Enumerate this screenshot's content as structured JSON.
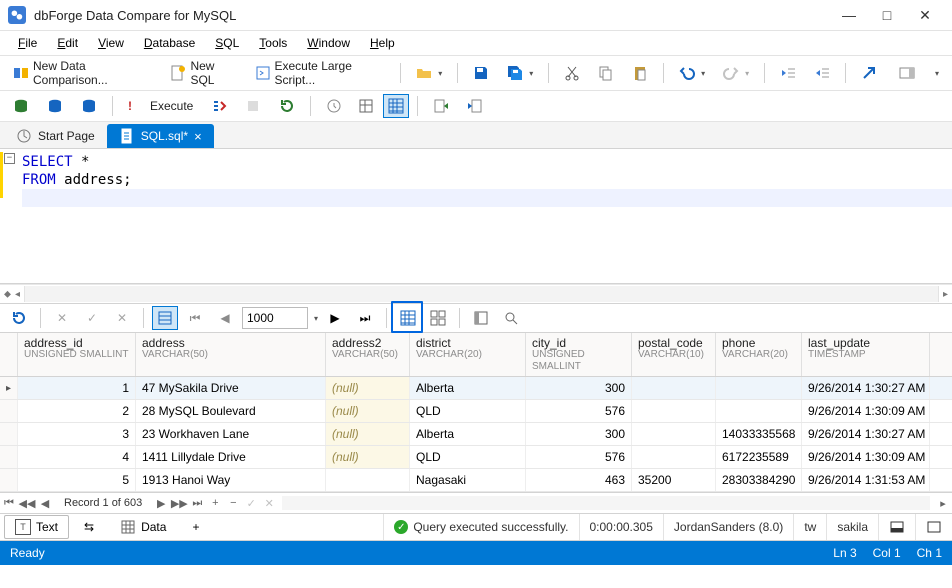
{
  "window": {
    "title": "dbForge Data Compare for MySQL"
  },
  "menu": {
    "file": "File",
    "edit": "Edit",
    "view": "View",
    "database": "Database",
    "sql": "SQL",
    "tools": "Tools",
    "window": "Window",
    "help": "Help"
  },
  "toolbar1": {
    "new_comp": "New Data Comparison...",
    "new_sql": "New SQL",
    "exec_script": "Execute Large Script..."
  },
  "toolbar2": {
    "execute": "Execute"
  },
  "tabs": {
    "start": "Start Page",
    "active": "SQL.sql*"
  },
  "sql": {
    "line1_kw": "SELECT",
    "line1_rest": " *",
    "line2_kw": "FROM",
    "line2_rest": " address;"
  },
  "midbar": {
    "page_size": "1000"
  },
  "grid": {
    "cols": [
      {
        "n": "address_id",
        "t": "UNSIGNED SMALLINT"
      },
      {
        "n": "address",
        "t": "VARCHAR(50)"
      },
      {
        "n": "address2",
        "t": "VARCHAR(50)"
      },
      {
        "n": "district",
        "t": "VARCHAR(20)"
      },
      {
        "n": "city_id",
        "t": "UNSIGNED SMALLINT"
      },
      {
        "n": "postal_code",
        "t": "VARCHAR(10)"
      },
      {
        "n": "phone",
        "t": "VARCHAR(20)"
      },
      {
        "n": "last_update",
        "t": "TIMESTAMP"
      }
    ],
    "rows": [
      {
        "id": "1",
        "addr": "47 MySakila Drive",
        "a2": null,
        "dist": "Alberta",
        "city": "300",
        "post": "",
        "ph": "",
        "lu": "9/26/2014 1:30:27 AM"
      },
      {
        "id": "2",
        "addr": "28 MySQL Boulevard",
        "a2": null,
        "dist": "QLD",
        "city": "576",
        "post": "",
        "ph": "",
        "lu": "9/26/2014 1:30:09 AM"
      },
      {
        "id": "3",
        "addr": "23 Workhaven Lane",
        "a2": null,
        "dist": "Alberta",
        "city": "300",
        "post": "",
        "ph": "14033335568",
        "lu": "9/26/2014 1:30:27 AM"
      },
      {
        "id": "4",
        "addr": "1411 Lillydale Drive",
        "a2": null,
        "dist": "QLD",
        "city": "576",
        "post": "",
        "ph": "6172235589",
        "lu": "9/26/2014 1:30:09 AM"
      },
      {
        "id": "5",
        "addr": "1913 Hanoi Way",
        "a2": "",
        "dist": "Nagasaki",
        "city": "463",
        "post": "35200",
        "ph": "28303384290",
        "lu": "9/26/2014 1:31:53 AM"
      }
    ],
    "record": "Record 1 of 603"
  },
  "bottom_tabs": {
    "text": "Text",
    "data": "Data"
  },
  "status_right": {
    "msg": "Query executed successfully.",
    "time": "0:00:00.305",
    "conn": "JordanSanders (8.0)",
    "user": "tw",
    "db": "sakila"
  },
  "statusbar": {
    "ready": "Ready",
    "ln": "Ln 3",
    "col": "Col 1",
    "ch": "Ch 1"
  }
}
